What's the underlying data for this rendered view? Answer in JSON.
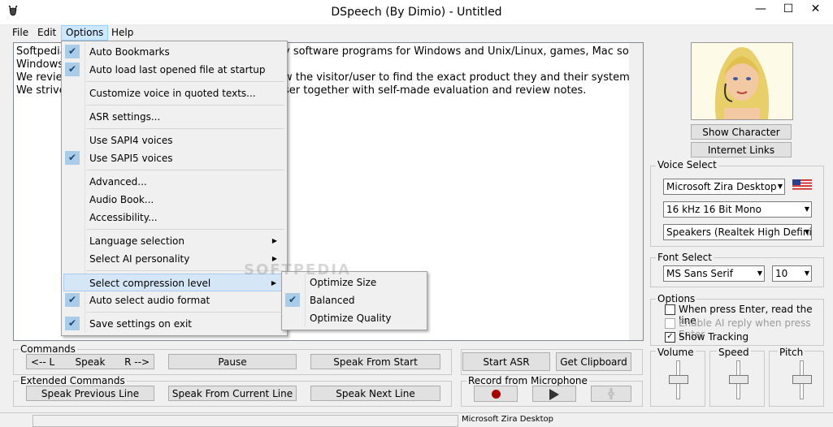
{
  "window": {
    "title": "DSpeech (By Dimio) - Untitled",
    "app_icon": "deer-icon"
  },
  "menubar": [
    "File",
    "Edit",
    "Options",
    "Help"
  ],
  "text_lines": [
    "Softpedia",
    "Windows",
    "We revie",
    "We strive"
  ],
  "text_lines_right": [
    "y software programs for Windows and Unix/Linux, games, Mac software,",
    "w the visitor/user to find the exact product they and their system needs.",
    "ser together with self-made evaluation and review notes."
  ],
  "options_menu": {
    "items": [
      {
        "label": "Auto Bookmarks",
        "checked": true
      },
      {
        "label": "Auto load last opened file at startup",
        "checked": true
      },
      {
        "label": "Customize voice in quoted texts..."
      },
      {
        "label": "ASR settings..."
      },
      {
        "label": "Use SAPI4 voices"
      },
      {
        "label": "Use SAPI5 voices",
        "checked": true
      },
      {
        "label": "Advanced..."
      },
      {
        "label": "Audio Book..."
      },
      {
        "label": "Accessibility..."
      },
      {
        "label": "Language selection",
        "submenu": true
      },
      {
        "label": "Select AI personality",
        "submenu": true
      },
      {
        "label": "Select compression level",
        "submenu": true,
        "highlighted": true
      },
      {
        "label": "Auto select audio format",
        "checked": true
      },
      {
        "label": "Save settings on exit",
        "checked": true
      }
    ]
  },
  "compression_submenu": [
    {
      "label": "Optimize Size"
    },
    {
      "label": "Balanced",
      "checked": true
    },
    {
      "label": "Optimize Quality"
    }
  ],
  "watermark": "SOFTPEDIA",
  "character": {
    "show_character": "Show Character",
    "internet_links": "Internet Links"
  },
  "voice_select": {
    "label": "Voice Select",
    "voice": "Microsoft Zira Desktop",
    "format": "16 kHz 16 Bit Mono",
    "output": "Speakers (Realtek High Definition A"
  },
  "font_select": {
    "label": "Font Select",
    "font": "MS Sans Serif",
    "size": "10"
  },
  "options_group": {
    "label": "Options",
    "items": [
      {
        "label": "When press Enter, read the line",
        "checked": false,
        "enabled": true
      },
      {
        "label": "Enable AI reply when press Enter",
        "checked": false,
        "enabled": false
      },
      {
        "label": "Show Tracking",
        "checked": true,
        "enabled": true
      }
    ]
  },
  "commands": {
    "label": "Commands",
    "back": "<-- L",
    "speak": "Speak",
    "forward": "R -->",
    "pause": "Pause",
    "speak_from_start": "Speak From Start"
  },
  "asr": {
    "start": "Start ASR",
    "clipboard": "Get Clipboard"
  },
  "extended": {
    "label": "Extended Commands",
    "prev": "Speak Previous Line",
    "current": "Speak From Current Line",
    "next": "Speak Next Line"
  },
  "record": {
    "label": "Record from Microphone"
  },
  "sliders": {
    "volume": "Volume",
    "speed": "Speed",
    "pitch": "Pitch"
  },
  "status": {
    "voice": "Microsoft Zira Desktop"
  }
}
